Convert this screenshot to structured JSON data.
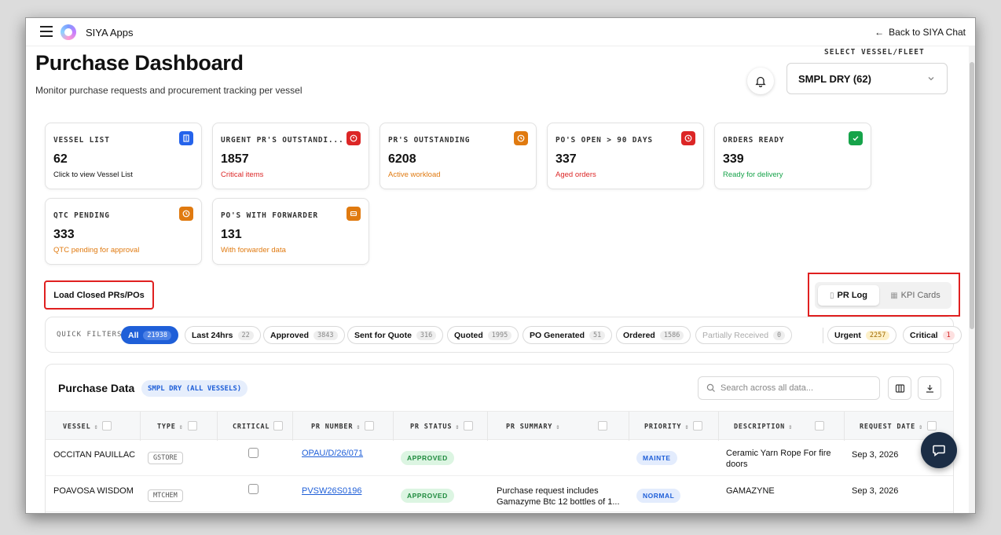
{
  "app": {
    "name": "SIYA Apps",
    "back_label": "Back to SIYA Chat"
  },
  "page": {
    "title": "Purchase Dashboard",
    "subtitle": "Monitor purchase requests and procurement tracking per vessel"
  },
  "vessel_select": {
    "label": "SELECT VESSEL/FLEET",
    "value": "SMPL DRY (62)"
  },
  "kpi_cards": [
    {
      "title": "VESSEL LIST",
      "value": "62",
      "sub": "Click to view Vessel List",
      "icon": "building-icon",
      "color": "#2563eb",
      "sub_color": "#111111"
    },
    {
      "title": "URGENT PR'S OUTSTANDI...",
      "value": "1857",
      "sub": "Critical items",
      "icon": "alert-circle-icon",
      "color": "#dc2626",
      "sub_color": "#dc2626"
    },
    {
      "title": "PR'S OUTSTANDING",
      "value": "6208",
      "sub": "Active workload",
      "icon": "clock-icon",
      "color": "#e07a10",
      "sub_color": "#e07a10"
    },
    {
      "title": "PO'S OPEN > 90 DAYS",
      "value": "337",
      "sub": "Aged orders",
      "icon": "alert-circle-icon",
      "color": "#dc2626",
      "sub_color": "#dc2626"
    },
    {
      "title": "ORDERS READY",
      "value": "339",
      "sub": "Ready for delivery",
      "icon": "check-icon",
      "color": "#16a34a",
      "sub_color": "#16a34a"
    },
    {
      "title": "QTC PENDING",
      "value": "333",
      "sub": "QTC pending for approval",
      "icon": "clock-icon",
      "color": "#e07a10",
      "sub_color": "#e07a10"
    },
    {
      "title": "PO'S WITH FORWARDER",
      "value": "131",
      "sub": "With forwarder data",
      "icon": "table-icon",
      "color": "#e07a10",
      "sub_color": "#e07a10"
    }
  ],
  "load_closed_label": "Load Closed PRs/POs",
  "view_toggle": {
    "pr_log": "PR Log",
    "kpi_cards": "KPI Cards"
  },
  "quick_filters": {
    "label": "QUICK FILTERS",
    "chips": [
      {
        "label": "All",
        "count": "21938"
      },
      {
        "label": "Last 24hrs",
        "count": "22"
      },
      {
        "label": "Approved",
        "count": "3843"
      },
      {
        "label": "Sent for Quote",
        "count": "316"
      },
      {
        "label": "Quoted",
        "count": "1995"
      },
      {
        "label": "PO Generated",
        "count": "51"
      },
      {
        "label": "Ordered",
        "count": "1586"
      },
      {
        "label": "Partially Received",
        "count": "0"
      },
      {
        "label": "Urgent",
        "count": "2257"
      },
      {
        "label": "Critical",
        "count": "1"
      }
    ]
  },
  "purchase_data": {
    "title": "Purchase Data",
    "badge": "SMPL DRY (ALL VESSELS)",
    "search_placeholder": "Search across all data...",
    "columns": [
      "VESSEL",
      "TYPE",
      "CRITICAL",
      "PR NUMBER",
      "PR STATUS",
      "PR SUMMARY",
      "PRIORITY",
      "DESCRIPTION",
      "REQUEST DATE"
    ],
    "rows": [
      {
        "vessel": "OCCITAN PAUILLAC",
        "type": "GSTORE",
        "pr_number": "OPAU/D/26/071",
        "status": "APPROVED",
        "summary_1": "",
        "summary_2": "",
        "priority": "MAINTE",
        "description_1": "Ceramic Yarn Rope For fire",
        "description_2": "doors",
        "date": "Sep 3, 2026"
      },
      {
        "vessel": "POAVOSA WISDOM",
        "type": "MTCHEM",
        "pr_number": "PVSW26S0196",
        "status": "APPROVED",
        "summary_1": "Purchase request includes",
        "summary_2": "Gamazyme Btc 12 bottles of 1...",
        "priority": "NORMAL",
        "description_1": "GAMAZYNE",
        "description_2": "",
        "date": "Sep 3, 2026"
      }
    ]
  }
}
